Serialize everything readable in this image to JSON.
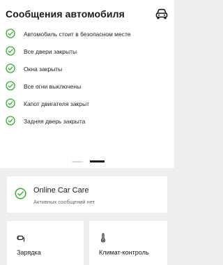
{
  "header": {
    "title": "Сообщения автомобиля",
    "icon": "car-icon"
  },
  "status_items": [
    {
      "label": "Автомобиль стоит в безопасном месте",
      "icon": "check-circle-icon"
    },
    {
      "label": "Все двери закрыты",
      "icon": "check-circle-icon"
    },
    {
      "label": "Окна закрыты",
      "icon": "check-circle-icon"
    },
    {
      "label": "Все огни выключены",
      "icon": "check-circle-icon"
    },
    {
      "label": "Капот двигателя закрыт",
      "icon": "check-circle-icon"
    },
    {
      "label": "Задняя дверь закрыта",
      "icon": "check-circle-icon"
    }
  ],
  "pager": {
    "total": 2,
    "active": 2
  },
  "online_car_care": {
    "title": "Online Car Care",
    "subtitle": "Активных сообщений нет",
    "icon": "check-circle-icon"
  },
  "tiles": {
    "charging": {
      "label": "Зарядка",
      "icon": "charging-plug-icon"
    },
    "climate": {
      "label": "Климат-контроль",
      "icon": "thermometer-icon"
    }
  },
  "colors": {
    "check_green": "#3aaa35",
    "background": "#eeeeee",
    "card": "#ffffff",
    "text": "#1a1a1a"
  }
}
